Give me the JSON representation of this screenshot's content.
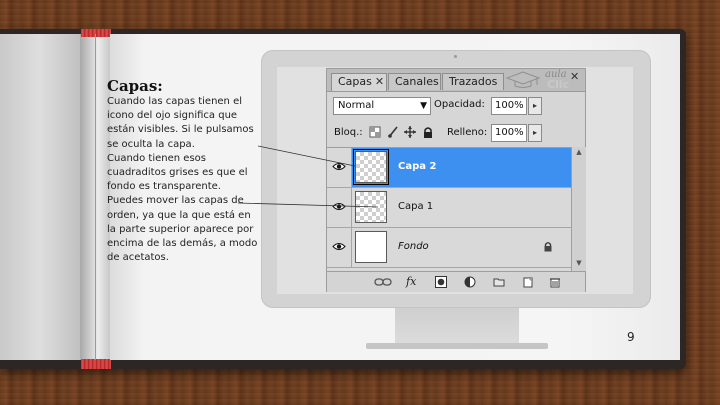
{
  "page": {
    "heading": "Capas:",
    "body_lines": [
      "Cuando las capas tienen el",
      "icono del ojo significa que",
      "están visibles. Si le pulsamos",
      "se oculta la capa.",
      "Cuando tienen esos",
      "cuadraditos grises es que el",
      "fondo es transparente.",
      "Puedes mover las capas de",
      "orden, ya que la que está en",
      "la parte superior aparece por",
      "encima de las demás, a modo",
      "de acetatos."
    ],
    "page_number": "9"
  },
  "panel": {
    "tabs": [
      {
        "label": "Capas",
        "active": true,
        "closable": true
      },
      {
        "label": "Canales",
        "active": false
      },
      {
        "label": "Trazados",
        "active": false
      }
    ],
    "watermark": {
      "line1": "aula",
      "line2": "Clic"
    },
    "blend_mode": "Normal",
    "opacity_label": "Opacidad:",
    "opacity_value": "100%",
    "lock_label": "Bloq.:",
    "fill_label": "Relleno:",
    "fill_value": "100%",
    "selection_color": "#3d8ff0",
    "layers": [
      {
        "name": "Capa 2",
        "visible": true,
        "selected": true,
        "thumbnail": "transparent",
        "locked": false
      },
      {
        "name": "Capa 1",
        "visible": true,
        "selected": false,
        "thumbnail": "transparent",
        "locked": false
      },
      {
        "name": "Fondo",
        "visible": true,
        "selected": false,
        "thumbnail": "white",
        "locked": true
      }
    ],
    "footer_icons": [
      "link-icon",
      "fx-icon",
      "mask-icon",
      "adjustment-icon",
      "group-icon",
      "new-layer-icon",
      "trash-icon"
    ],
    "footer_fx": "fx"
  }
}
